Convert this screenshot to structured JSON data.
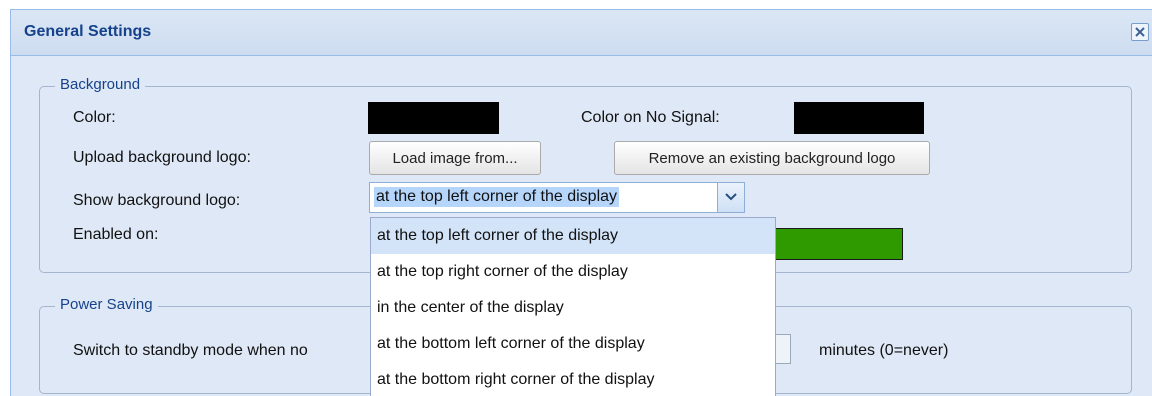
{
  "window": {
    "title": "General Settings",
    "close_icon": "close-icon"
  },
  "background": {
    "legend": "Background",
    "color_label": "Color:",
    "color_value": "#000000",
    "no_signal_label": "Color on No Signal:",
    "no_signal_value": "#000000",
    "upload_label": "Upload background logo:",
    "load_button": "Load image from...",
    "remove_button": "Remove an existing background logo",
    "show_label": "Show background logo:",
    "show_selected": "at the top left corner of the display",
    "enabled_label": "Enabled on:",
    "enabled_color": "#2e9a00"
  },
  "power": {
    "legend": "Power Saving",
    "standby_label": "Switch to standby mode when no",
    "minutes_label": "minutes (0=never)"
  },
  "dropdown": {
    "options": [
      "at the top left corner of the display",
      "at the top right corner of the display",
      "in the center of the display",
      "at the bottom left corner of the display",
      "at the bottom right corner of the display"
    ],
    "selected_index": 0
  }
}
